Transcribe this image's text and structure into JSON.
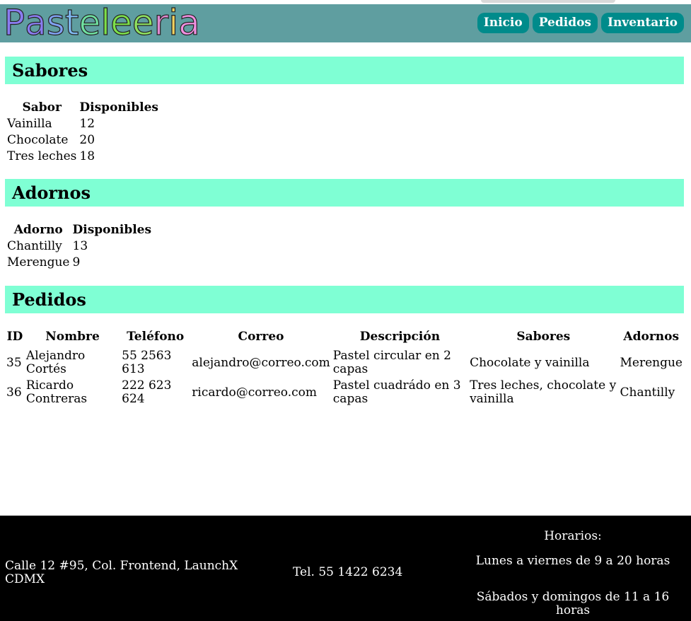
{
  "header": {
    "logo_letters": [
      {
        "ch": "P",
        "color": "#8a7cf0"
      },
      {
        "ch": "a",
        "color": "#8a7cf0"
      },
      {
        "ch": "s",
        "color": "#7fa0f0"
      },
      {
        "ch": "t",
        "color": "#7fb8f0"
      },
      {
        "ch": "e",
        "color": "#6fe0a0"
      },
      {
        "ch": "l",
        "color": "#7de04a"
      },
      {
        "ch": "e",
        "color": "#7de04a"
      },
      {
        "ch": "e",
        "color": "#8ee060"
      },
      {
        "ch": "r",
        "color": "#e08ad0"
      },
      {
        "ch": "i",
        "color": "#f0d060"
      },
      {
        "ch": "a",
        "color": "#f090e0"
      }
    ],
    "logo_text": "Pasteleería",
    "nav": [
      "Inicio",
      "Pedidos",
      "Inventario"
    ]
  },
  "sabores": {
    "title": "Sabores",
    "headers": [
      "Sabor",
      "Disponibles"
    ],
    "rows": [
      [
        "Vainilla",
        "12"
      ],
      [
        "Chocolate",
        "20"
      ],
      [
        "Tres leches",
        "18"
      ]
    ]
  },
  "adornos": {
    "title": "Adornos",
    "headers": [
      "Adorno",
      "Disponibles"
    ],
    "rows": [
      [
        "Chantilly",
        "13"
      ],
      [
        "Merengue",
        "9"
      ]
    ]
  },
  "pedidos": {
    "title": "Pedidos",
    "headers": [
      "ID",
      "Nombre",
      "Teléfono",
      "Correo",
      "Descripción",
      "Sabores",
      "Adornos"
    ],
    "rows": [
      [
        "35",
        "Alejandro Cortés",
        "55 2563 613",
        "alejandro@correo.com",
        "Pastel circular en 2 capas",
        "Chocolate y vainilla",
        "Merengue"
      ],
      [
        "36",
        "Ricardo Contreras",
        "222 623 624",
        "ricardo@correo.com",
        "Pastel cuadrádo en 3 capas",
        "Tres leches, chocolate y vainilla",
        "Chantilly"
      ]
    ]
  },
  "footer": {
    "address": "Calle 12 #95, Col. Frontend, LaunchX CDMX",
    "phone": "Tel. 55 1422 6234",
    "hours_title": "Horarios:",
    "hours_weekdays": "Lunes a viernes de 9 a 20 horas",
    "hours_weekend": "Sábados y domingos de 11 a 16 horas"
  },
  "colors": {
    "header_bg": "#5f9ea0",
    "nav_bg": "#008b8b",
    "section_bg": "#7fffd4",
    "footer_bg": "#000000"
  }
}
